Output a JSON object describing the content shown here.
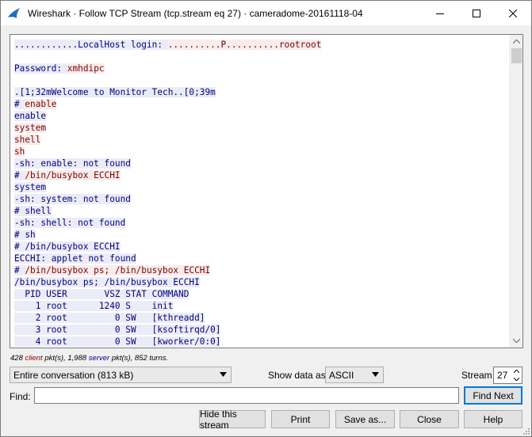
{
  "window": {
    "title": "Wireshark · Follow TCP Stream (tcp.stream eq 27) · cameradome-20161118-04"
  },
  "stream": {
    "lines": [
      [
        {
          "t": "............LocalHost login: ",
          "k": "c"
        },
        {
          "t": "..........P..........rootroot",
          "k": "s"
        }
      ],
      [],
      [
        {
          "t": "Password: ",
          "k": "c"
        },
        {
          "t": "xmhdipc",
          "k": "s"
        }
      ],
      [],
      [
        {
          "t": ".[1;32mWelcome to Monitor Tech..[0;39m",
          "k": "c"
        }
      ],
      [
        {
          "t": "# ",
          "k": "c"
        },
        {
          "t": "enable",
          "k": "s"
        }
      ],
      [
        {
          "t": "enable",
          "k": "c"
        }
      ],
      [
        {
          "t": "system",
          "k": "s"
        }
      ],
      [
        {
          "t": "shell",
          "k": "s"
        }
      ],
      [
        {
          "t": "sh",
          "k": "s"
        }
      ],
      [
        {
          "t": "-sh: enable: not found",
          "k": "c"
        }
      ],
      [
        {
          "t": "# ",
          "k": "c"
        },
        {
          "t": "/bin/busybox ECCHI",
          "k": "s"
        }
      ],
      [
        {
          "t": "system",
          "k": "c"
        }
      ],
      [
        {
          "t": "-sh: system: not found",
          "k": "c"
        }
      ],
      [
        {
          "t": "# shell",
          "k": "c"
        }
      ],
      [
        {
          "t": "-sh: shell: not found",
          "k": "c"
        }
      ],
      [
        {
          "t": "# sh",
          "k": "c"
        }
      ],
      [
        {
          "t": "# /bin/busybox ECCHI",
          "k": "c"
        }
      ],
      [
        {
          "t": "ECCHI: applet not found",
          "k": "c"
        }
      ],
      [
        {
          "t": "# ",
          "k": "c"
        },
        {
          "t": "/bin/busybox ps; /bin/busybox ECCHI",
          "k": "s"
        }
      ],
      [
        {
          "t": "/bin/busybox ps; /bin/busybox ECCHI",
          "k": "c"
        }
      ],
      [
        {
          "t": "  PID USER       VSZ STAT COMMAND",
          "k": "c"
        }
      ],
      [
        {
          "t": "    1 root      1240 S    init",
          "k": "c"
        }
      ],
      [
        {
          "t": "    2 root         0 SW   [kthreadd]",
          "k": "c"
        }
      ],
      [
        {
          "t": "    3 root         0 SW   [ksoftirqd/0]",
          "k": "c"
        }
      ],
      [
        {
          "t": "    4 root         0 SW   [kworker/0:0]",
          "k": "c"
        }
      ]
    ]
  },
  "stats": {
    "client_count": "428",
    "client_word": "client",
    "pkts_mid": "pkt(s), 1,988",
    "server_word": "server",
    "tail": "pkt(s), 852 turns."
  },
  "controls": {
    "conversation": "Entire conversation (813 kB)",
    "show_data_label": "Show data as",
    "show_data_value": "ASCII",
    "stream_label": "Stream",
    "stream_value": "27",
    "find_label": "Find:",
    "find_value": "",
    "find_next_label": "Find Next"
  },
  "buttons": {
    "hide": "Hide this stream",
    "print": "Print",
    "save": "Save as...",
    "close": "Close",
    "help": "Help"
  },
  "colors": {
    "client_fg": "#7f0000",
    "client_bg": "#f8ecec",
    "server_fg": "#00007f",
    "server_bg": "#ececf8",
    "focus": "#0078d7"
  },
  "icons": [
    "wireshark-fin-icon",
    "minimize-icon",
    "maximize-icon",
    "close-icon",
    "chevron-down-icon",
    "scroll-up-icon",
    "scroll-down-icon",
    "spin-up-icon",
    "spin-down-icon",
    "resize-grip-icon"
  ]
}
